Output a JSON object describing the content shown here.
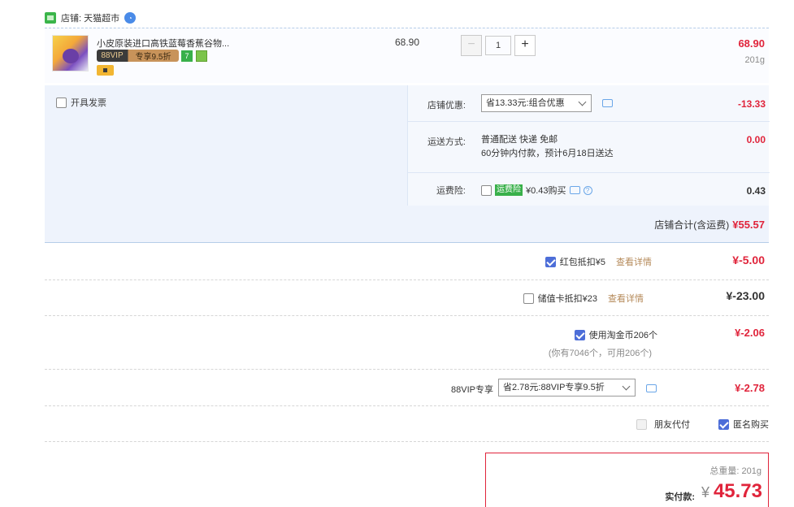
{
  "shop": {
    "name": "店铺: 天猫超市"
  },
  "item": {
    "title": "小皮原装进口高铁蓝莓香蕉谷物...",
    "vip_tag_prefix": "88VIP",
    "vip_tag_discount": "专享9.5折",
    "tag_seven": "7",
    "unit_price": "68.90",
    "quantity": "1",
    "minus": "−",
    "plus": "+",
    "total": "68.90",
    "weight": "201g"
  },
  "invoice": {
    "label": "开具发票"
  },
  "shop_discount": {
    "label": "店铺优惠:",
    "selected": "省13.33元:组合优惠",
    "amount": "-13.33"
  },
  "shipping": {
    "label": "运送方式:",
    "line1": "普通配送 快递 免邮",
    "line2": "60分钟内付款，预计6月18日送达",
    "amount": "0.00"
  },
  "insurance": {
    "label": "运费险:",
    "tag": "运费险",
    "text": "¥0.43购买",
    "help": "?",
    "amount": "0.43"
  },
  "shop_total": {
    "label": "店铺合计(含运费)",
    "amount": "¥55.57"
  },
  "red_packet": {
    "label": "红包抵扣¥5",
    "link": "查看详情",
    "amount": "¥-5.00",
    "checked": true
  },
  "stored_card": {
    "label": "储值卡抵扣¥23",
    "link": "查看详情",
    "amount": "¥-23.00",
    "checked": false
  },
  "taojinbi": {
    "label": "使用淘金币206个",
    "note": "(你有7046个，可用206个)",
    "amount": "¥-2.06",
    "checked": true
  },
  "vip88": {
    "label": "88VIP专享",
    "selected": "省2.78元:88VIP专享9.5折",
    "amount": "¥-2.78"
  },
  "options": {
    "friend_pay": "朋友代付",
    "anonymous": "匿名购买"
  },
  "payment": {
    "weight": "总重量: 201g",
    "label": "实付款:",
    "currency": "¥",
    "amount": "45.73"
  },
  "colors": {
    "price_red": "#e0243b",
    "link_brown": "#b58a5a",
    "panel_blue": "#eef3fc",
    "check_blue": "#4d6ed8"
  }
}
